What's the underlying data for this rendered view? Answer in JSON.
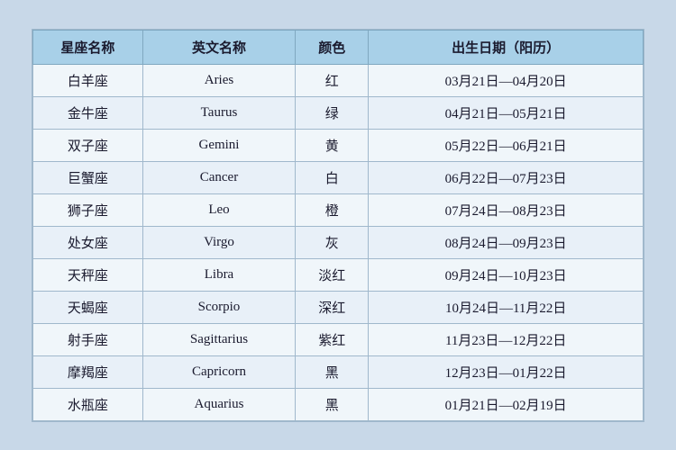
{
  "table": {
    "headers": {
      "chinese_name": "星座名称",
      "english_name": "英文名称",
      "color": "颜色",
      "birthday": "出生日期（阳历）"
    },
    "rows": [
      {
        "chinese": "白羊座",
        "english": "Aries",
        "color": "红",
        "date": "03月21日—04月20日"
      },
      {
        "chinese": "金牛座",
        "english": "Taurus",
        "color": "绿",
        "date": "04月21日—05月21日"
      },
      {
        "chinese": "双子座",
        "english": "Gemini",
        "color": "黄",
        "date": "05月22日—06月21日"
      },
      {
        "chinese": "巨蟹座",
        "english": "Cancer",
        "color": "白",
        "date": "06月22日—07月23日"
      },
      {
        "chinese": "狮子座",
        "english": "Leo",
        "color": "橙",
        "date": "07月24日—08月23日"
      },
      {
        "chinese": "处女座",
        "english": "Virgo",
        "color": "灰",
        "date": "08月24日—09月23日"
      },
      {
        "chinese": "天秤座",
        "english": "Libra",
        "color": "淡红",
        "date": "09月24日—10月23日"
      },
      {
        "chinese": "天蝎座",
        "english": "Scorpio",
        "color": "深红",
        "date": "10月24日—11月22日"
      },
      {
        "chinese": "射手座",
        "english": "Sagittarius",
        "color": "紫红",
        "date": "11月23日—12月22日"
      },
      {
        "chinese": "摩羯座",
        "english": "Capricorn",
        "color": "黑",
        "date": "12月23日—01月22日"
      },
      {
        "chinese": "水瓶座",
        "english": "Aquarius",
        "color": "黑",
        "date": "01月21日—02月19日"
      }
    ]
  }
}
